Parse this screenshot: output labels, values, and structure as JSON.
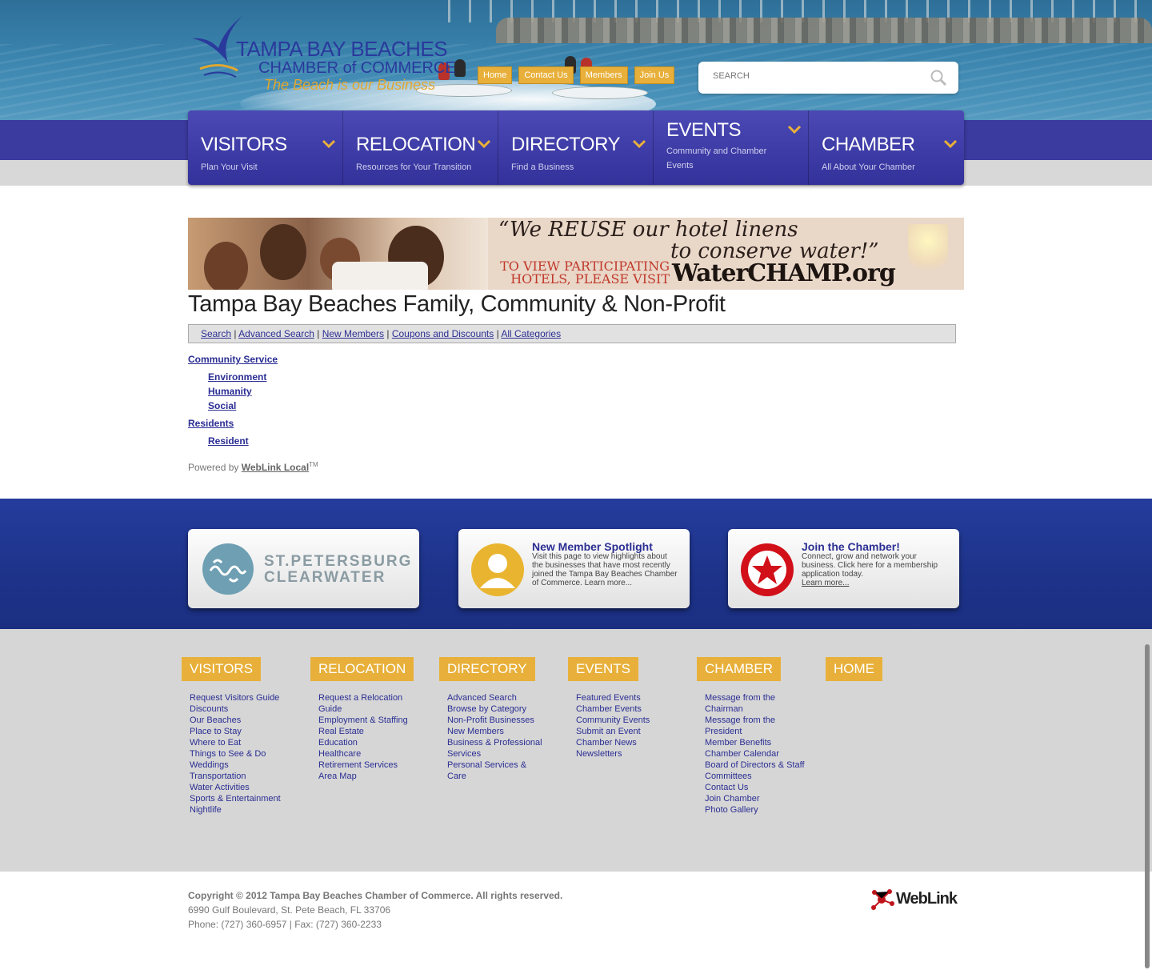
{
  "header": {
    "logo": {
      "line1": "TAMPA BAY BEACHES",
      "line2": "CHAMBER of COMMERCE",
      "tagline": "The Beach is our Business"
    },
    "top_links": [
      "Home",
      "Contact Us",
      "Members",
      "Join Us"
    ],
    "search": {
      "placeholder": "SEARCH"
    }
  },
  "main_nav": [
    {
      "title": "VISITORS",
      "subtitle": "Plan Your Visit"
    },
    {
      "title": "RELOCATION",
      "subtitle": "Resources for Your Transition"
    },
    {
      "title": "DIRECTORY",
      "subtitle": "Find a Business"
    },
    {
      "title": "EVENTS",
      "subtitle": "Community and Chamber Events"
    },
    {
      "title": "CHAMBER",
      "subtitle": "All About Your Chamber"
    }
  ],
  "banner": {
    "quote_line1": "“We REUSE our hotel linens",
    "quote_line2": "to conserve water!”",
    "visit_line1": "TO VIEW PARTICIPATING",
    "visit_line2": "HOTELS, PLEASE VISIT",
    "url": "WaterCHAMP.org"
  },
  "page_title": "Tampa Bay Beaches Family, Community & Non-Profit",
  "link_bar": [
    "Search",
    "Advanced Search",
    "New Members",
    "Coupons and Discounts",
    "All Categories"
  ],
  "categories": [
    {
      "label": "Community Service",
      "children": [
        "Environment",
        "Humanity",
        "Social"
      ]
    },
    {
      "label": "Residents",
      "children": [
        "Resident"
      ]
    }
  ],
  "powered": {
    "prefix": "Powered by ",
    "link": "WebLink Local",
    "tm": "TM"
  },
  "promo_cards": [
    {
      "logo_line1": "ST.PETERSBURG",
      "logo_line2": "CLEARWATER"
    },
    {
      "title": "New Member Spotlight",
      "body": "Visit this page to view highlights about the businesses that have most recently joined the Tampa Bay Beaches Chamber of Commerce. Learn more..."
    },
    {
      "title": "Join the Chamber!",
      "body": "Connect, grow and network your business. Click here for a membership application today.",
      "link": "Learn more..."
    }
  ],
  "footer_columns": [
    {
      "title": "VISITORS",
      "links": [
        "Request Visitors Guide",
        "Discounts",
        "Our Beaches",
        "Place to Stay",
        "Where to Eat",
        "Things to See & Do",
        "Weddings",
        "Transportation",
        "Water Activities",
        "Sports & Entertainment",
        "Nightlife"
      ]
    },
    {
      "title": "RELOCATION",
      "links": [
        "Request a Relocation Guide",
        "Employment & Staffing",
        "Real Estate",
        "Education",
        "Healthcare",
        "Retirement Services",
        "Area Map"
      ]
    },
    {
      "title": "DIRECTORY",
      "links": [
        "Advanced Search",
        "Browse by Category",
        "Non-Profit Businesses",
        "New Members",
        "Business & Professional Services",
        "Personal Services & Care"
      ]
    },
    {
      "title": "EVENTS",
      "links": [
        "Featured Events",
        "Chamber Events",
        "Community Events",
        "Submit an Event",
        "Chamber News",
        "Newsletters"
      ]
    },
    {
      "title": "CHAMBER",
      "links": [
        "Message from the Chairman",
        "Message from the President",
        "Member Benefits",
        "Chamber Calendar",
        "Board of Directors & Staff",
        "Committees",
        "Contact Us",
        "Join Chamber",
        "Photo Gallery"
      ]
    },
    {
      "title": "HOME",
      "links": []
    }
  ],
  "copyright": {
    "line1": "Copyright © 2012 Tampa Bay Beaches Chamber of Commerce.  All rights reserved.",
    "line2": "6990 Gulf Boulevard, St. Pete Beach, FL 33706",
    "line3": "Phone: (727) 360-6957 | Fax: (727) 360-2233"
  },
  "weblink_logo": "WebLink"
}
